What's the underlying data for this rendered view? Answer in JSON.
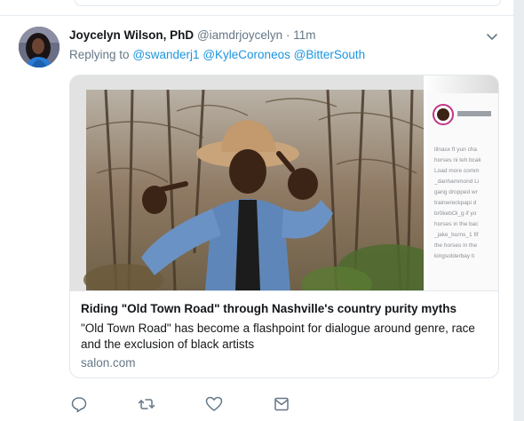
{
  "tweet": {
    "author_name": "Joycelyn Wilson, PhD",
    "author_handle": "@iamdrjoycelyn",
    "separator": "·",
    "timestamp": "11m",
    "replying_prefix": "Replying to",
    "mentions": [
      "@swanderj1",
      "@KyleCoroneos",
      "@BitterSouth"
    ]
  },
  "card": {
    "title": "Riding \"Old Town Road\" through Nashville's country purity myths",
    "description": "\"Old Town Road\" has become a flashpoint for dialogue around genre, race and the exclusion of black artists",
    "domain": "salon.com"
  },
  "instagram_overlay": {
    "lines": [
      "lilnasx ft yun cha",
      "horses ni teh bcak",
      "Load more comm",
      "_danhammond Li",
      "gang dropped wr",
      "trainwreckpapi d",
      "br0kebOi_g if yo",
      "horses in the bac",
      "_jake_burns_1 fif",
      "the horses in the",
      "kingsolderbay ti"
    ]
  },
  "actions": {
    "icons": [
      "reply-icon",
      "retweet-icon",
      "like-icon",
      "dm-icon"
    ]
  },
  "colors": {
    "link": "#1b95e0",
    "secondary_text": "#657786",
    "primary_text": "#14171a",
    "border": "#e1e8ed"
  }
}
